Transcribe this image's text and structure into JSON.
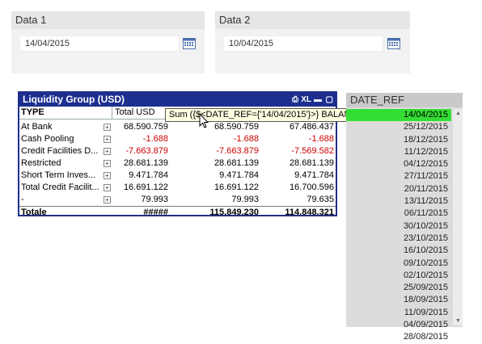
{
  "date1": {
    "title": "Data 1",
    "value": "14/04/2015"
  },
  "date2": {
    "title": "Data 2",
    "value": "10/04/2015"
  },
  "liquidity": {
    "title": "Liquidity Group (USD)",
    "xl_label": "XL",
    "headers": [
      "TYPE",
      "Total USD"
    ],
    "rows": [
      {
        "type": "At Bank",
        "c1": "68.590.759",
        "c2": "68.590.759",
        "c3": "67.486.437",
        "neg": false
      },
      {
        "type": "Cash Pooling",
        "c1": "-1.688",
        "c2": "-1.688",
        "c3": "-1.688",
        "neg": true
      },
      {
        "type": "Credit Facilities D...",
        "c1": "-7.663.879",
        "c2": "-7.663.879",
        "c3": "-7.569.582",
        "neg": true
      },
      {
        "type": "Restricted",
        "c1": "28.681.139",
        "c2": "28.681.139",
        "c3": "28.681.139",
        "neg": false
      },
      {
        "type": "Short Term Inves...",
        "c1": "9.471.784",
        "c2": "9.471.784",
        "c3": "9.471.784",
        "neg": false
      },
      {
        "type": "Total Credit Facilit...",
        "c1": "16.691.122",
        "c2": "16.691.122",
        "c3": "16.700.596",
        "neg": false
      },
      {
        "type": "-",
        "c1": "79.993",
        "c2": "79.993",
        "c3": "79.635",
        "neg": false
      }
    ],
    "total": {
      "label": "Totale",
      "c1": "#####",
      "c2": "115.849.230",
      "c3": "114.848.321"
    },
    "tooltip": "Sum ({$<DATE_REF={'14/04/2015'}>} BALANCE_CTV2)"
  },
  "date_ref": {
    "title": "DATE_REF",
    "selected": "14/04/2015",
    "items": [
      "14/04/2015",
      "25/12/2015",
      "18/12/2015",
      "11/12/2015",
      "04/12/2015",
      "27/11/2015",
      "20/11/2015",
      "13/11/2015",
      "06/11/2015",
      "30/10/2015",
      "23/10/2015",
      "16/10/2015",
      "09/10/2015",
      "02/10/2015",
      "25/09/2015",
      "18/09/2015",
      "11/09/2015",
      "04/09/2015",
      "28/08/2015"
    ]
  },
  "colors": {
    "title_bar": "#1c2f8f",
    "selected": "#33dd33",
    "negative": "#cc0000"
  }
}
